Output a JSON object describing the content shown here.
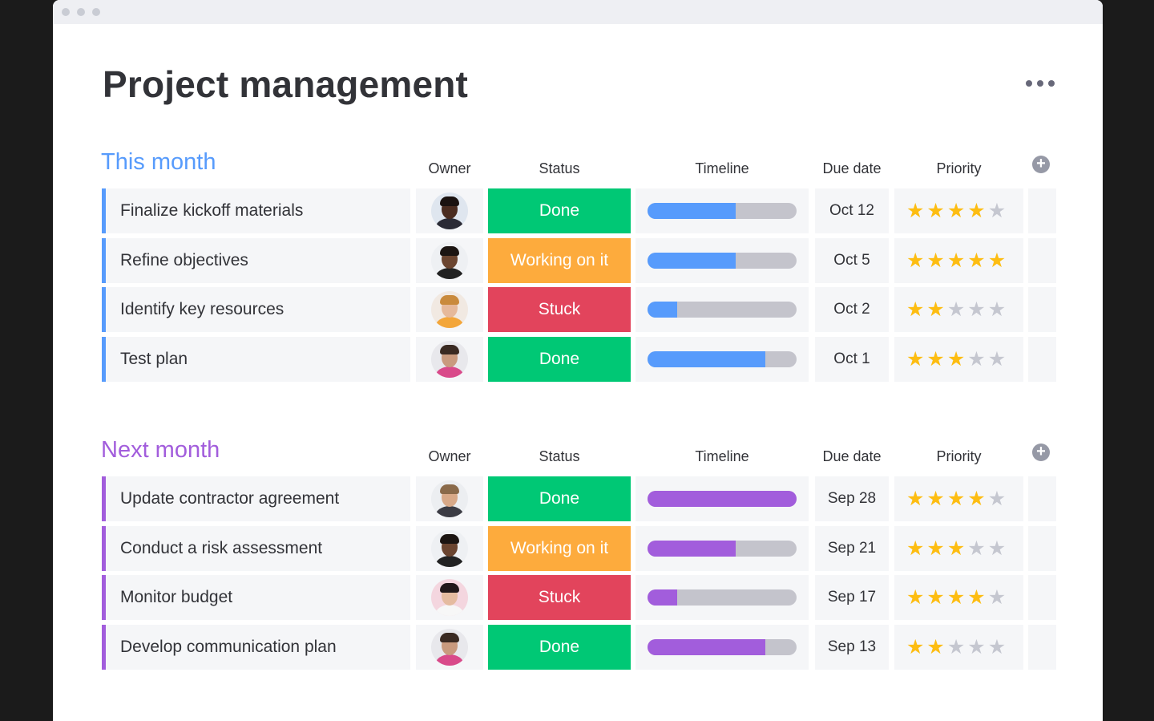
{
  "title": "Project management",
  "more_menu_icon": "more-horizontal-icon",
  "columns": {
    "owner": "Owner",
    "status": "Status",
    "timeline": "Timeline",
    "due": "Due date",
    "priority": "Priority"
  },
  "status_colors": {
    "Done": "#00c875",
    "Working on it": "#fdab3d",
    "Stuck": "#e2445c"
  },
  "groups": [
    {
      "title": "This month",
      "color": "#579bfc",
      "rows": [
        {
          "name": "Finalize kickoff materials",
          "owner_avatar": "avatar-1",
          "status": "Done",
          "timeline_progress": 0.59,
          "due": "Oct 12",
          "priority": 4
        },
        {
          "name": "Refine objectives",
          "owner_avatar": "avatar-2",
          "status": "Working on it",
          "timeline_progress": 0.59,
          "due": "Oct 5",
          "priority": 5
        },
        {
          "name": "Identify key resources",
          "owner_avatar": "avatar-3",
          "status": "Stuck",
          "timeline_progress": 0.2,
          "due": "Oct 2",
          "priority": 2
        },
        {
          "name": "Test plan",
          "owner_avatar": "avatar-4",
          "status": "Done",
          "timeline_progress": 0.79,
          "due": "Oct 1",
          "priority": 3
        }
      ]
    },
    {
      "title": "Next month",
      "color": "#a25ddc",
      "rows": [
        {
          "name": "Update contractor agreement",
          "owner_avatar": "avatar-5",
          "status": "Done",
          "timeline_progress": 1.0,
          "due": "Sep 28",
          "priority": 4
        },
        {
          "name": "Conduct a risk assessment",
          "owner_avatar": "avatar-2",
          "status": "Working on it",
          "timeline_progress": 0.59,
          "due": "Sep 21",
          "priority": 3
        },
        {
          "name": "Monitor budget",
          "owner_avatar": "avatar-6",
          "status": "Stuck",
          "timeline_progress": 0.2,
          "due": "Sep 17",
          "priority": 4
        },
        {
          "name": "Develop communication plan",
          "owner_avatar": "avatar-4",
          "status": "Done",
          "timeline_progress": 0.79,
          "due": "Sep 13",
          "priority": 2
        }
      ]
    }
  ]
}
